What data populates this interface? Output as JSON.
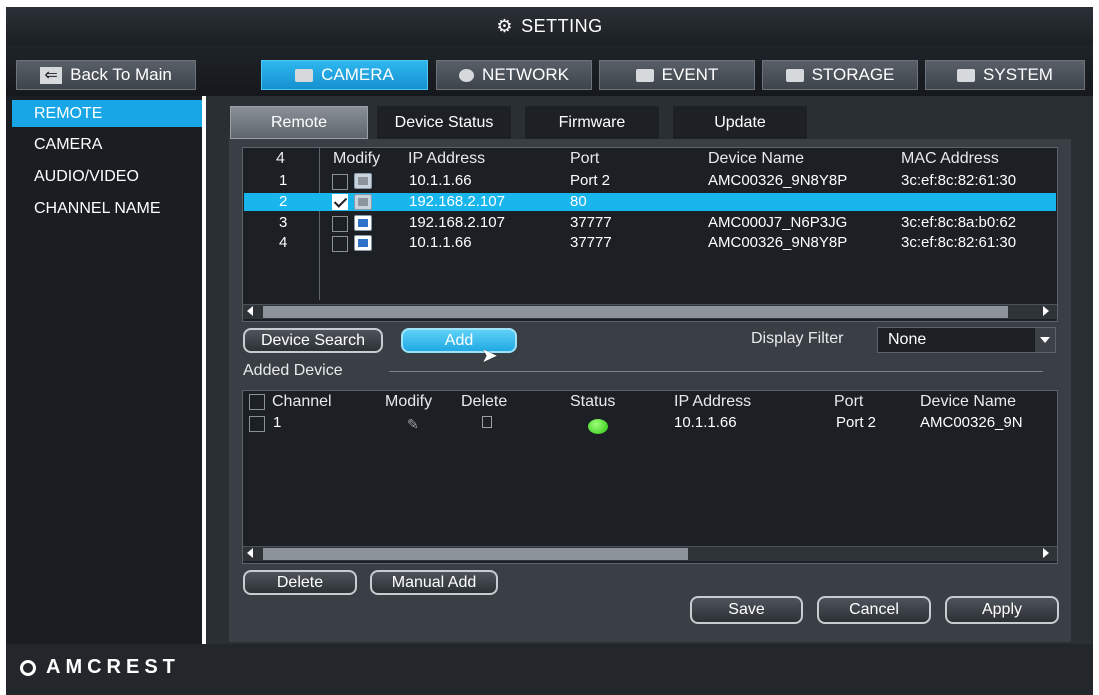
{
  "title": "SETTING",
  "nav": {
    "back_label": "Back To Main",
    "tabs": [
      "CAMERA",
      "NETWORK",
      "EVENT",
      "STORAGE",
      "SYSTEM"
    ]
  },
  "sidebar": {
    "items": [
      "REMOTE",
      "CAMERA",
      "AUDIO/VIDEO",
      "CHANNEL NAME"
    ]
  },
  "subtabs": [
    "Remote",
    "Device Status",
    "Firmware",
    "Update"
  ],
  "search_table": {
    "count": "4",
    "headers": [
      "Modify",
      "IP Address",
      "Port",
      "Device Name",
      "MAC Address"
    ],
    "rows": [
      {
        "no": "1",
        "ip": "10.1.1.66",
        "port": "Port 2",
        "name": "AMC00326_9N8Y8P",
        "mac": "3c:ef:8c:82:61:30"
      },
      {
        "no": "2",
        "ip": "192.168.2.107",
        "port": "80",
        "name": "",
        "mac": ""
      },
      {
        "no": "3",
        "ip": "192.168.2.107",
        "port": "37777",
        "name": "AMC000J7_N6P3JG",
        "mac": "3c:ef:8c:8a:b0:62"
      },
      {
        "no": "4",
        "ip": "10.1.1.66",
        "port": "37777",
        "name": "AMC00326_9N8Y8P",
        "mac": "3c:ef:8c:82:61:30"
      }
    ]
  },
  "buttons": {
    "device_search": "Device Search",
    "add": "Add",
    "delete": "Delete",
    "manual_add": "Manual Add",
    "save": "Save",
    "cancel": "Cancel",
    "apply": "Apply"
  },
  "filter": {
    "label": "Display Filter",
    "value": "None"
  },
  "added_device": {
    "label": "Added Device",
    "headers": [
      "Channel",
      "Modify",
      "Delete",
      "Status",
      "IP Address",
      "Port",
      "Device Name"
    ],
    "rows": [
      {
        "channel": "1",
        "ip": "10.1.1.66",
        "port": "Port 2",
        "name": "AMC00326_9N"
      }
    ]
  },
  "logo": "AMCREST",
  "colors": {
    "accent": "#19a6e6",
    "status_online": "#3fdc1f"
  }
}
